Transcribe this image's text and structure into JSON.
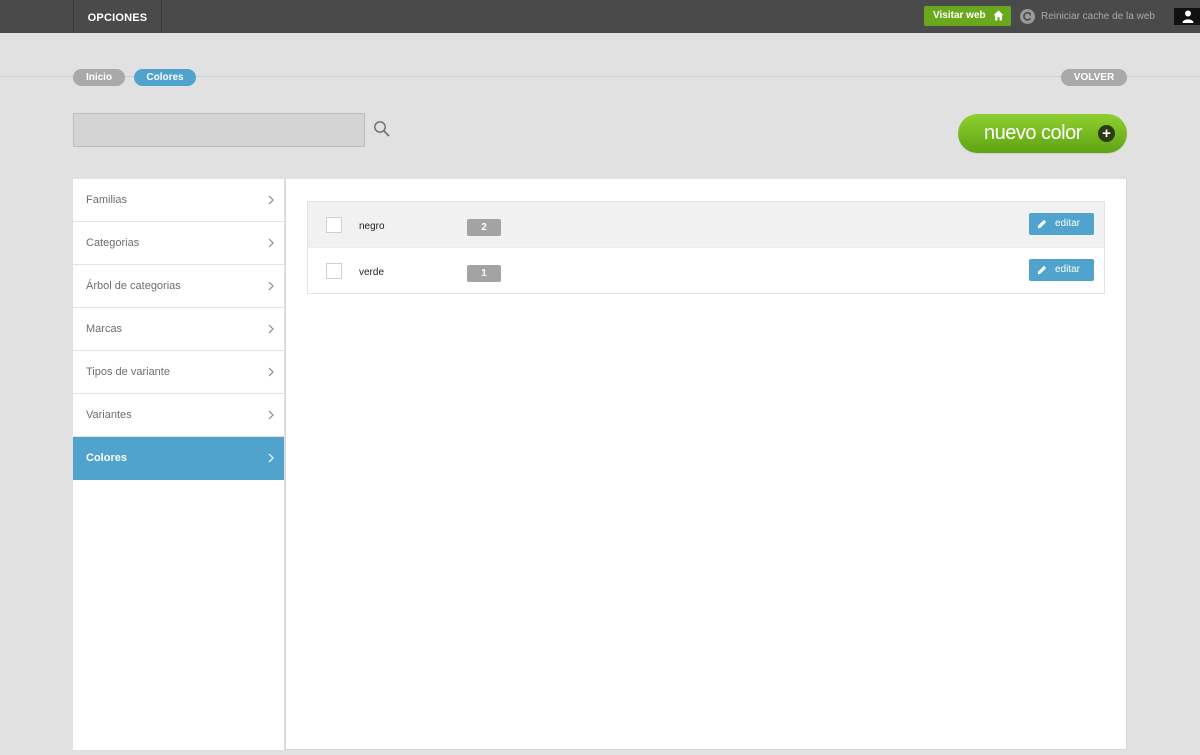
{
  "topbar": {
    "menu_label": "OPCIONES",
    "visit_label": "Visitar web",
    "cache_label": "Reiniciar cache de la web"
  },
  "breadcrumb": {
    "home": "Inicio",
    "current": "Colores",
    "back": "VOLVER"
  },
  "search": {
    "value": "",
    "placeholder": ""
  },
  "new_button": {
    "label": "nuevo color",
    "icon": "+"
  },
  "sidebar": {
    "items": [
      {
        "label": "Familias",
        "active": false
      },
      {
        "label": "Categorias",
        "active": false
      },
      {
        "label": "Árbol de categorias",
        "active": false
      },
      {
        "label": "Marcas",
        "active": false
      },
      {
        "label": "Tipos de variante",
        "active": false
      },
      {
        "label": "Variantes",
        "active": false
      },
      {
        "label": "Colores",
        "active": true
      }
    ]
  },
  "colors": {
    "edit_label": "editar",
    "rows": [
      {
        "name": "negro",
        "count": "2"
      },
      {
        "name": "verde",
        "count": "1"
      }
    ]
  },
  "theme": {
    "accent": "#4fa3cc",
    "green": "#6aa91e",
    "topbar": "#4a4a4a"
  }
}
